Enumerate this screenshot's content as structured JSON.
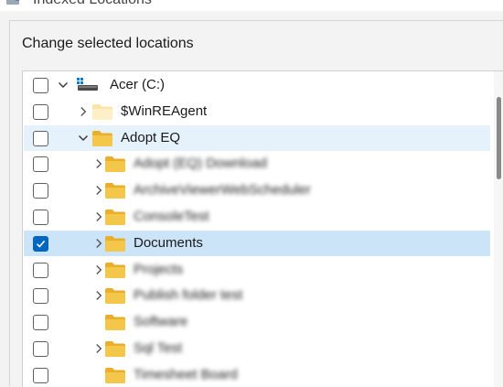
{
  "window": {
    "title": "Indexed Locations"
  },
  "group": {
    "label": "Change selected locations"
  },
  "tree": [
    {
      "label": "Acer (C:)",
      "type": "drive",
      "checked": false,
      "expand": "down",
      "level": 0,
      "style": ""
    },
    {
      "label": "$WinREAgent",
      "type": "folder-pale",
      "checked": false,
      "expand": "right",
      "level": 1,
      "style": ""
    },
    {
      "label": "Adopt EQ",
      "type": "folder",
      "checked": false,
      "expand": "down",
      "level": 1,
      "style": "highlight"
    },
    {
      "label": "Adopt (EQ) Download",
      "type": "folder",
      "checked": false,
      "expand": "right",
      "level": 2,
      "style": "",
      "blurred": true
    },
    {
      "label": "ArchiveViewerWebScheduler",
      "type": "folder",
      "checked": false,
      "expand": "right",
      "level": 2,
      "style": "",
      "blurred": true
    },
    {
      "label": "ConsoleTest",
      "type": "folder",
      "checked": false,
      "expand": "right",
      "level": 2,
      "style": "",
      "blurred": true
    },
    {
      "label": "Documents",
      "type": "folder",
      "checked": true,
      "expand": "right",
      "level": 2,
      "style": "selected"
    },
    {
      "label": "Projects",
      "type": "folder",
      "checked": false,
      "expand": "right",
      "level": 2,
      "style": "",
      "blurred": true
    },
    {
      "label": "Publish folder test",
      "type": "folder",
      "checked": false,
      "expand": "right",
      "level": 2,
      "style": "",
      "blurred": true
    },
    {
      "label": "Software",
      "type": "folder",
      "checked": false,
      "expand": "none",
      "level": 2,
      "style": "",
      "blurred": true
    },
    {
      "label": "Sql Test",
      "type": "folder",
      "checked": false,
      "expand": "right",
      "level": 2,
      "style": "",
      "blurred": true
    },
    {
      "label": "Timesheet Board",
      "type": "folder",
      "checked": false,
      "expand": "none",
      "level": 2,
      "style": "",
      "blurred": true
    }
  ],
  "colors": {
    "accent": "#0067c0",
    "selected_row": "#cce4f7",
    "hover_row": "#e5f1fb",
    "folder": "#f4c64a"
  },
  "icons": {
    "window": "indexing-options-icon",
    "drive": "drive-icon",
    "folder": "folder-icon",
    "expand_right": "chevron-right-icon",
    "expand_down": "chevron-down-icon",
    "check": "checkmark-icon"
  }
}
